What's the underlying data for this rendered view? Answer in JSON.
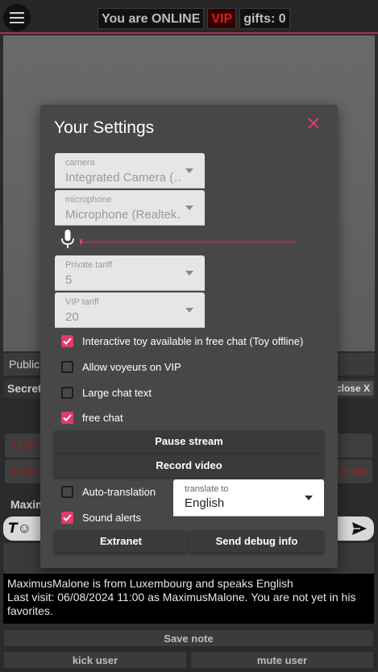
{
  "header": {
    "status_text": "You are ONLINE",
    "vip_label": "VIP",
    "gifts_text": "gifts: 0"
  },
  "background": {
    "public_tab": "Public",
    "secret_label": "Secret",
    "close_label": "close X",
    "msg_time_1": "11:00",
    "msg_time_2": "11:00",
    "credits_text": "credits",
    "user_name_partial": "Maxim",
    "input_icons": "𝙏☺"
  },
  "modal": {
    "title": "Your Settings",
    "camera": {
      "label": "camera",
      "value": "Integrated Camera (…"
    },
    "microphone": {
      "label": "microphone",
      "value": "Microphone (Realtek…"
    },
    "private_tariff": {
      "label": "Private tariff",
      "value": "5"
    },
    "vip_tariff": {
      "label": "VIP tariff",
      "value": "20"
    },
    "checkboxes": [
      {
        "label": "Interactive toy available in free chat (Toy offline)",
        "checked": true
      },
      {
        "label": "Allow voyeurs on VIP",
        "checked": false
      },
      {
        "label": "Large chat text",
        "checked": false
      },
      {
        "label": "free chat",
        "checked": true
      }
    ],
    "pause_stream_label": "Pause stream",
    "record_video_label": "Record video",
    "auto_translation": {
      "label": "Auto-translation",
      "checked": false
    },
    "sound_alerts": {
      "label": "Sound alerts",
      "checked": true
    },
    "translate_to": {
      "label": "translate to",
      "value": "English"
    },
    "extranet_label": "Extranet",
    "send_debug_label": "Send debug info",
    "mic_level": 0.0
  },
  "info": {
    "line1": "MaximusMalone is from Luxembourg and speaks English",
    "line2": "Last visit: 06/08/2024 11:00 as MaximusMalone. You are not yet in his favorites."
  },
  "footer": {
    "save_note_label": "Save note",
    "kick_user_label": "kick user",
    "mute_user_label": "mute user"
  },
  "colors": {
    "accent": "#e03b6a",
    "vip": "#d32020"
  }
}
